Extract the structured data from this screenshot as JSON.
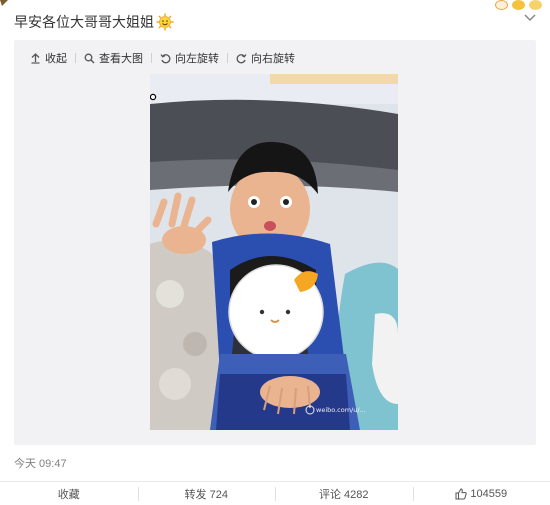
{
  "post": {
    "text": "早安各位大哥哥大姐姐",
    "emoji_icon": "sun-face-emoji",
    "timestamp": "今天 09:47"
  },
  "toolbar": {
    "collapse": "收起",
    "view_large": "查看大图",
    "rotate_left": "向左旋转",
    "rotate_right": "向右旋转"
  },
  "photo": {
    "watermark": "weibo.com/u/..."
  },
  "actions": {
    "favorite": "收藏",
    "repost": "转发 724",
    "comment": "评论 4282",
    "like": "104559"
  },
  "colors": {
    "panel_bg": "#f2f2f5",
    "text_main": "#333333",
    "text_muted": "#808080",
    "accent_orange": "#f5a623"
  }
}
